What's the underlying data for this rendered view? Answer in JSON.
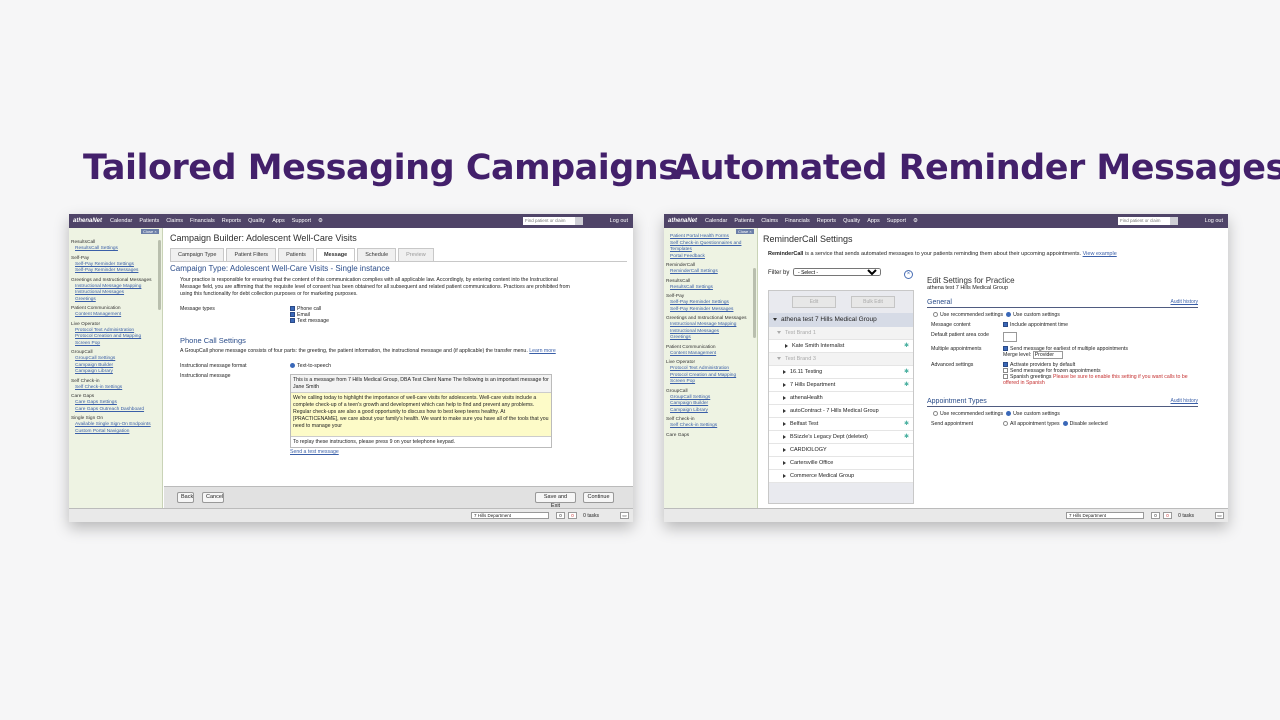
{
  "headlines": {
    "left": "Tailored Messaging Campaigns",
    "right": "Automated Reminder Messages"
  },
  "nav": {
    "logo": "athenaNet",
    "items": [
      "Calendar",
      "Patients",
      "Claims",
      "Financials",
      "Reports",
      "Quality",
      "Apps",
      "Support"
    ],
    "search_placeholder": "Find patient or claim",
    "logout": "Log out"
  },
  "left_screen": {
    "close_sidebar": "Close ×",
    "sidebar": [
      {
        "section": "ResultsCall",
        "links": [
          "ResultsCall Settings"
        ]
      },
      {
        "section": "Self-Pay",
        "links": [
          "Self-Pay Reminder Settings",
          "Self-Pay Reminder Messages"
        ]
      },
      {
        "section": "Greetings and Instructional Messages",
        "links": [
          "Instructional Message Mapping",
          "Instructional Messages",
          "Greetings"
        ]
      },
      {
        "section": "Patient Communication",
        "links": [
          "Content Management"
        ]
      },
      {
        "section": "Live Operator",
        "links": [
          "Protocol Text Administration",
          "Protocol Creation and Mapping",
          "Screen Pop"
        ]
      },
      {
        "section": "GroupCall",
        "links": [
          "GroupCall Settings",
          "Campaign Builder",
          "Campaign Library"
        ]
      },
      {
        "section": "Self Check-in",
        "links": [
          "Self Check-in Settings"
        ]
      },
      {
        "section": "Care Gaps",
        "links": [
          "Care Gaps Settings",
          "Care Gaps Outreach Dashboard"
        ]
      },
      {
        "section": "Single Sign On",
        "links": [
          "Available Single Sign-On Endpoints",
          "Custom Portal Navigation"
        ]
      }
    ],
    "page_title": "Campaign Builder: Adolescent Well-Care Visits",
    "tabs": [
      "Campaign Type",
      "Patient Filters",
      "Patients",
      "Message",
      "Schedule",
      "Preview"
    ],
    "active_tab": "Message",
    "campaign_type": "Campaign Type: Adolescent Well-Care Visits - Single instance",
    "compliance_text": "Your practice is responsible for ensuring that the content of this communication complies with all applicable law. Accordingly, by entering content into the Instructional Message field, you are affirming that the requisite level of consent has been obtained for all subsequent and related patient communications. Practices are prohibited from using this functionality for debt collection purposes or for marketing purposes.",
    "message_types_label": "Message types",
    "message_types": [
      "Phone call",
      "Email",
      "Text message"
    ],
    "phone_settings_title": "Phone Call Settings",
    "phone_settings_desc": "A GroupCall phone message consists of four parts: the greeting, the patient information, the instructional message and (if applicable) the transfer menu.",
    "learn_more": "Learn more",
    "instr_format_label": "Instructional message format",
    "instr_format_value": "Text-to-speech",
    "instr_message_label": "Instructional message",
    "msg_header": "This is a message from 7 Hills Medical Group, DBA Test Client Name  The following is an important message for Jane Smith",
    "msg_body": "We're calling today to highlight the importance of well-care visits for adolescents. Well-care visits include a complete check-up of a teen's growth and development which can help to find and prevent any problems. Regular check-ups are also a good opportunity to discuss how to best keep teens healthy. At [PRACTICENAME], we care about your family's health. We want to make sure you have all of the tools that you need to manage your",
    "msg_footer": "To replay these instructions, please press 9 on your telephone keypad.",
    "send_test": "Send a test message",
    "buttons": {
      "back": "Back",
      "cancel": "Cancel",
      "save_exit": "Save and Exit",
      "continue": "Continue"
    }
  },
  "right_screen": {
    "close_sidebar": "Close ×",
    "sidebar": [
      {
        "section": "",
        "links": [
          "Patient Portal Health Forms",
          "Self Check-in Questionnaires and Templates",
          "Portal Feedback"
        ]
      },
      {
        "section": "ReminderCall",
        "links": [
          "ReminderCall Settings"
        ]
      },
      {
        "section": "ResultsCall",
        "links": [
          "ResultsCall Settings"
        ]
      },
      {
        "section": "Self-Pay",
        "links": [
          "Self-Pay Reminder Settings",
          "Self-Pay Reminder Messages"
        ]
      },
      {
        "section": "Greetings and Instructional Messages",
        "links": [
          "Instructional Message Mapping",
          "Instructional Messages",
          "Greetings"
        ]
      },
      {
        "section": "Patient Communication",
        "links": [
          "Content Management"
        ]
      },
      {
        "section": "Live Operator",
        "links": [
          "Protocol Text Administration",
          "Protocol Creation and Mapping",
          "Screen Pop"
        ]
      },
      {
        "section": "GroupCall",
        "links": [
          "GroupCall Settings",
          "Campaign Builder",
          "Campaign Library"
        ]
      },
      {
        "section": "Self Check-in",
        "links": [
          "Self Check-in Settings"
        ]
      },
      {
        "section": "Care Gaps",
        "links": []
      }
    ],
    "page_title": "ReminderCall Settings",
    "intro_bold": "ReminderCall",
    "intro_text": " is a service that sends automated messages to your patients reminding them about their upcoming appointments.",
    "view_example": "View example",
    "filter_label": "Filter by",
    "filter_value": "- Select -",
    "edit": "Edit",
    "bulk_edit": "Bulk Edit",
    "tree_root": "athena test 7 Hills Medical Group",
    "tree_items": [
      {
        "label": "Test Brand 1",
        "type": "group",
        "star": false
      },
      {
        "label": "Kate Smith Internalist",
        "type": "child",
        "star": true
      },
      {
        "label": "Test Brand 3",
        "type": "group",
        "star": false
      },
      {
        "label": "16.11 Testing",
        "type": "item",
        "star": true
      },
      {
        "label": "7 Hills Department",
        "type": "item",
        "star": true
      },
      {
        "label": "athenaHealth",
        "type": "item",
        "star": false
      },
      {
        "label": "autoContract - 7 Hills Medical Group",
        "type": "item",
        "star": false
      },
      {
        "label": "Belfast Test",
        "type": "item",
        "star": true
      },
      {
        "label": "BSizzle's Legacy Dept (deleted)",
        "type": "item",
        "star": true
      },
      {
        "label": "CARDIOLOGY",
        "type": "item",
        "star": false
      },
      {
        "label": "Cartersville Office",
        "type": "item",
        "star": false
      },
      {
        "label": "Commerce Medical Group",
        "type": "item",
        "star": false
      }
    ],
    "edit_title": "Edit Settings for Practice",
    "edit_sub": "athena test 7 Hills Medical Group",
    "general": "General",
    "audit": "Audit history",
    "use_recommended": "Use recommended settings",
    "use_custom": "Use custom settings",
    "message_content_label": "Message content",
    "message_content_value": "Include appointment time",
    "default_area_label": "Default patient area code",
    "multiple_label": "Multiple appointments",
    "multiple_value": "Send message for earliest of multiple appointments",
    "merge_level_label": "Merge level:",
    "merge_level_value": "Provider",
    "advanced_label": "Advanced settings",
    "advanced_1": "Activate providers by default",
    "advanced_2": "Send message for frozen appointments",
    "advanced_3": "Spanish greetings",
    "advanced_warn": "Please be sure to enable this setting if you want calls to be offered in Spanish",
    "appt_types": "Appointment Types",
    "send_appt_label": "Send appointment",
    "all_types": "All appointment types",
    "disable_selected": "Disable selected"
  },
  "status_bar": {
    "department": "7 Hills Department",
    "count_a": "0",
    "count_b": "0",
    "tasks": "0 tasks"
  }
}
